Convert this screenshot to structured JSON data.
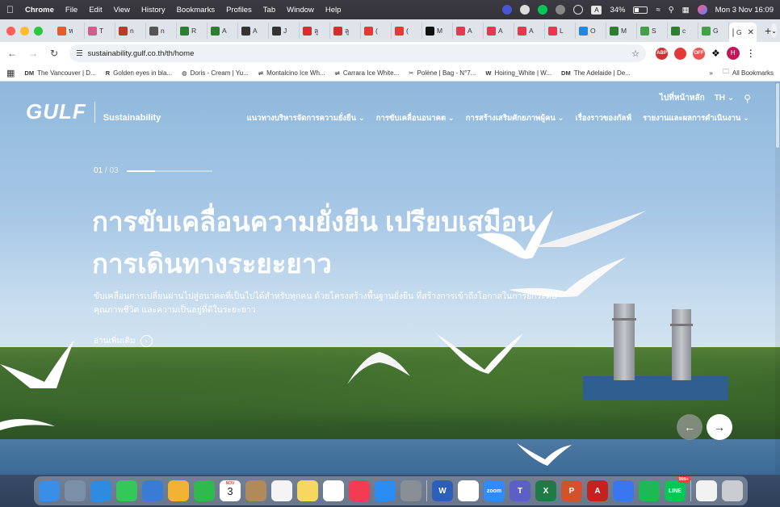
{
  "menubar": {
    "app": "Chrome",
    "items": [
      "File",
      "Edit",
      "View",
      "History",
      "Bookmarks",
      "Profiles",
      "Tab",
      "Window",
      "Help"
    ],
    "battery": "34%",
    "clock": "Mon 3 Nov  16:09",
    "input_indicator": "A"
  },
  "tabs": [
    {
      "label": "ห",
      "color": "#e35d2b"
    },
    {
      "label": "T",
      "color": "#d65a8a"
    },
    {
      "label": "n",
      "color": "#c0392b"
    },
    {
      "label": "n",
      "color": "#555555"
    },
    {
      "label": "R",
      "color": "#2e7d32"
    },
    {
      "label": "A",
      "color": "#2e7d32"
    },
    {
      "label": "A",
      "color": "#333333"
    },
    {
      "label": "J",
      "color": "#333333"
    },
    {
      "label": "ลู",
      "color": "#d32f2f"
    },
    {
      "label": "ลู",
      "color": "#d32f2f"
    },
    {
      "label": "(",
      "color": "#e53935"
    },
    {
      "label": "(",
      "color": "#e53935"
    },
    {
      "label": "M",
      "color": "#111111"
    },
    {
      "label": "A",
      "color": "#e53950"
    },
    {
      "label": "A",
      "color": "#e53950"
    },
    {
      "label": "A",
      "color": "#e53950"
    },
    {
      "label": "L",
      "color": "#e53950"
    },
    {
      "label": "O",
      "color": "#1e88e5"
    },
    {
      "label": "M",
      "color": "#2e7d32"
    },
    {
      "label": "S",
      "color": "#43a047"
    },
    {
      "label": "c",
      "color": "#2e7d32"
    },
    {
      "label": "G",
      "color": "#43a047"
    }
  ],
  "active_tab": {
    "label": "G"
  },
  "address": {
    "url": "sustainability.gulf.co.th/th/home"
  },
  "bookmarks": [
    {
      "icon": "DM",
      "label": "The Vancouver | D..."
    },
    {
      "icon": "R",
      "label": "Golden eyes in bla..."
    },
    {
      "icon": "◍",
      "label": "Doris - Cream | Yu..."
    },
    {
      "icon": "⇌",
      "label": "Montalcino Ice Wh..."
    },
    {
      "icon": "⇌",
      "label": "Carrara Ice White..."
    },
    {
      "icon": "✂",
      "label": "Polène | Bag - N°7..."
    },
    {
      "icon": "W",
      "label": "Hoiring_White | W..."
    },
    {
      "icon": "DM",
      "label": "The Adelaide | De..."
    }
  ],
  "bookmarks_more": "»",
  "all_bookmarks": "All Bookmarks",
  "site": {
    "logo": "GULF",
    "logo_sub": "Sustainability",
    "go_home": "ไปที่หน้าหลัก",
    "lang": "TH",
    "nav": [
      "แนวทางบริหารจัดการความยั่งยืน",
      "การขับเคลื่อนอนาคต",
      "การสร้างเสริมศักยภาพผู้คน",
      "เรื่องราวของกัลฟ์",
      "รายงานและผลการดำเนินงาน"
    ],
    "slide_current": "01",
    "slide_total": "/ 03",
    "slide_progress": 0.33,
    "headline_line1": "การขับเคลื่อนความยั่งยืน เปรียบเสมือน",
    "headline_line2": "การเดินทางระยะยาว",
    "description": "ขับเคลื่อนการเปลี่ยนผ่านไปสู่อนาคตที่เป็นไปได้สำหรับทุกคน ด้วยโครงสร้างพื้นฐานยั่งยืน ที่สร้างการเข้าถึงโอกาสในการยกระดับ คุณภาพชีวิต และความเป็นอยู่ที่ดีในระยะยาว",
    "read_more": "อ่านเพิ่มเติม"
  },
  "dock": [
    {
      "name": "finder",
      "color": "#3a8ee6"
    },
    {
      "name": "launchpad",
      "color": "#7b8fa8"
    },
    {
      "name": "safari",
      "color": "#2f8be0"
    },
    {
      "name": "messages",
      "color": "#35c759"
    },
    {
      "name": "mail",
      "color": "#3a7bd5"
    },
    {
      "name": "photos",
      "color": "#f2b233"
    },
    {
      "name": "facetime",
      "color": "#30b94d"
    },
    {
      "name": "calendar",
      "color": "#ffffff",
      "text": "3",
      "month": "NOV"
    },
    {
      "name": "contacts",
      "color": "#b08a5a"
    },
    {
      "name": "reminders",
      "color": "#f4f4f4"
    },
    {
      "name": "notes",
      "color": "#f6d860"
    },
    {
      "name": "freeform",
      "color": "#ffffff"
    },
    {
      "name": "music",
      "color": "#f43b54"
    },
    {
      "name": "app-store",
      "color": "#2b8cf2"
    },
    {
      "name": "system-settings",
      "color": "#8a8f97"
    },
    {
      "name": "word",
      "color": "#2b5fb9",
      "text": "W"
    },
    {
      "name": "chrome",
      "color": "#ffffff"
    },
    {
      "name": "zoom",
      "color": "#2d8cff",
      "text": "zoom"
    },
    {
      "name": "teams",
      "color": "#5b5fc7",
      "text": "T"
    },
    {
      "name": "excel",
      "color": "#1f7a45",
      "text": "X"
    },
    {
      "name": "powerpoint",
      "color": "#d2522c",
      "text": "P"
    },
    {
      "name": "acrobat",
      "color": "#c6201f",
      "text": "A"
    },
    {
      "name": "signal",
      "color": "#3a76f0"
    },
    {
      "name": "spotify",
      "color": "#1db954"
    },
    {
      "name": "line",
      "color": "#06c755",
      "text": "LINE",
      "badge": "999+"
    },
    {
      "name": "document",
      "color": "#f2f2f2"
    },
    {
      "name": "trash",
      "color": "#c9ccd1"
    }
  ]
}
